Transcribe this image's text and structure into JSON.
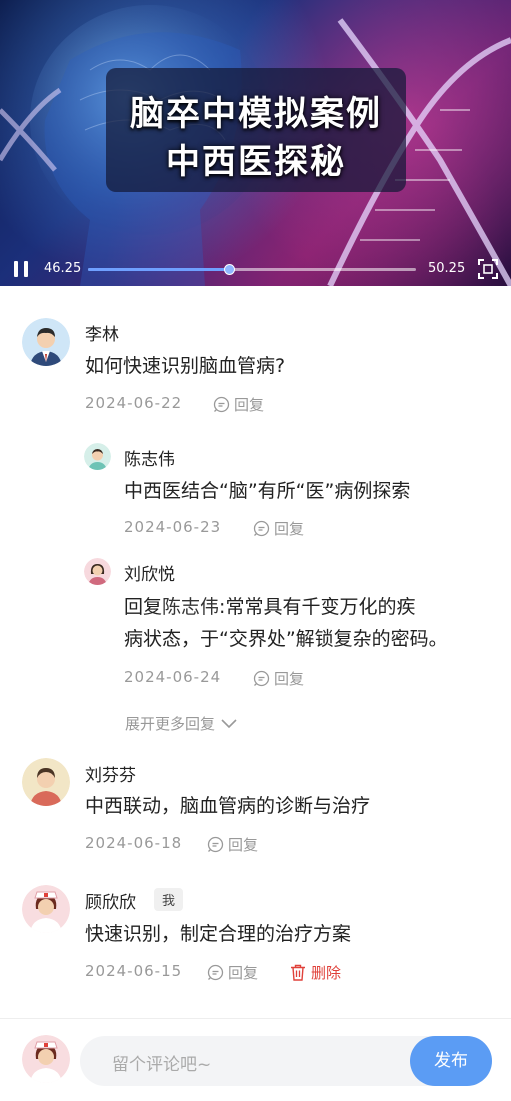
{
  "video": {
    "title_line1": "脑卒中模拟案例",
    "title_line2": "中西医探秘",
    "current_time": "46.25",
    "total_time": "50.25",
    "progress": 0.43
  },
  "reply_label": "回复",
  "delete_label": "删除",
  "comments": [
    {
      "name": "李林",
      "text": "如何快速识别脑血管病?",
      "date": "2024-06-22",
      "replies": [
        {
          "name": "陈志伟",
          "text": "中西医结合“脑”有所“医”病例探索",
          "date": "2024-06-23"
        },
        {
          "name": "刘欣悦",
          "reply_prefix": "回复",
          "reply_to": "陈志伟",
          "reply_sep": ":",
          "text_line1": "常常具有千变万化的疾",
          "text_line2": "病状态，于“交界处”解锁复杂的密码。",
          "date": "2024-06-24"
        }
      ],
      "expand_label": "展开更多回复"
    },
    {
      "name": "刘芬芬",
      "text": "中西联动，脑血管病的诊断与治疗",
      "date": "2024-06-18"
    },
    {
      "name": "顾欣欣",
      "badge": "我",
      "text": "快速识别，制定合理的治疗方案",
      "date": "2024-06-15"
    }
  ],
  "composer": {
    "placeholder": "留个评论吧~",
    "send_label": "发布"
  },
  "colors": {
    "accent": "#5b9cf4",
    "delete": "#e0413a",
    "meta": "#999999"
  }
}
